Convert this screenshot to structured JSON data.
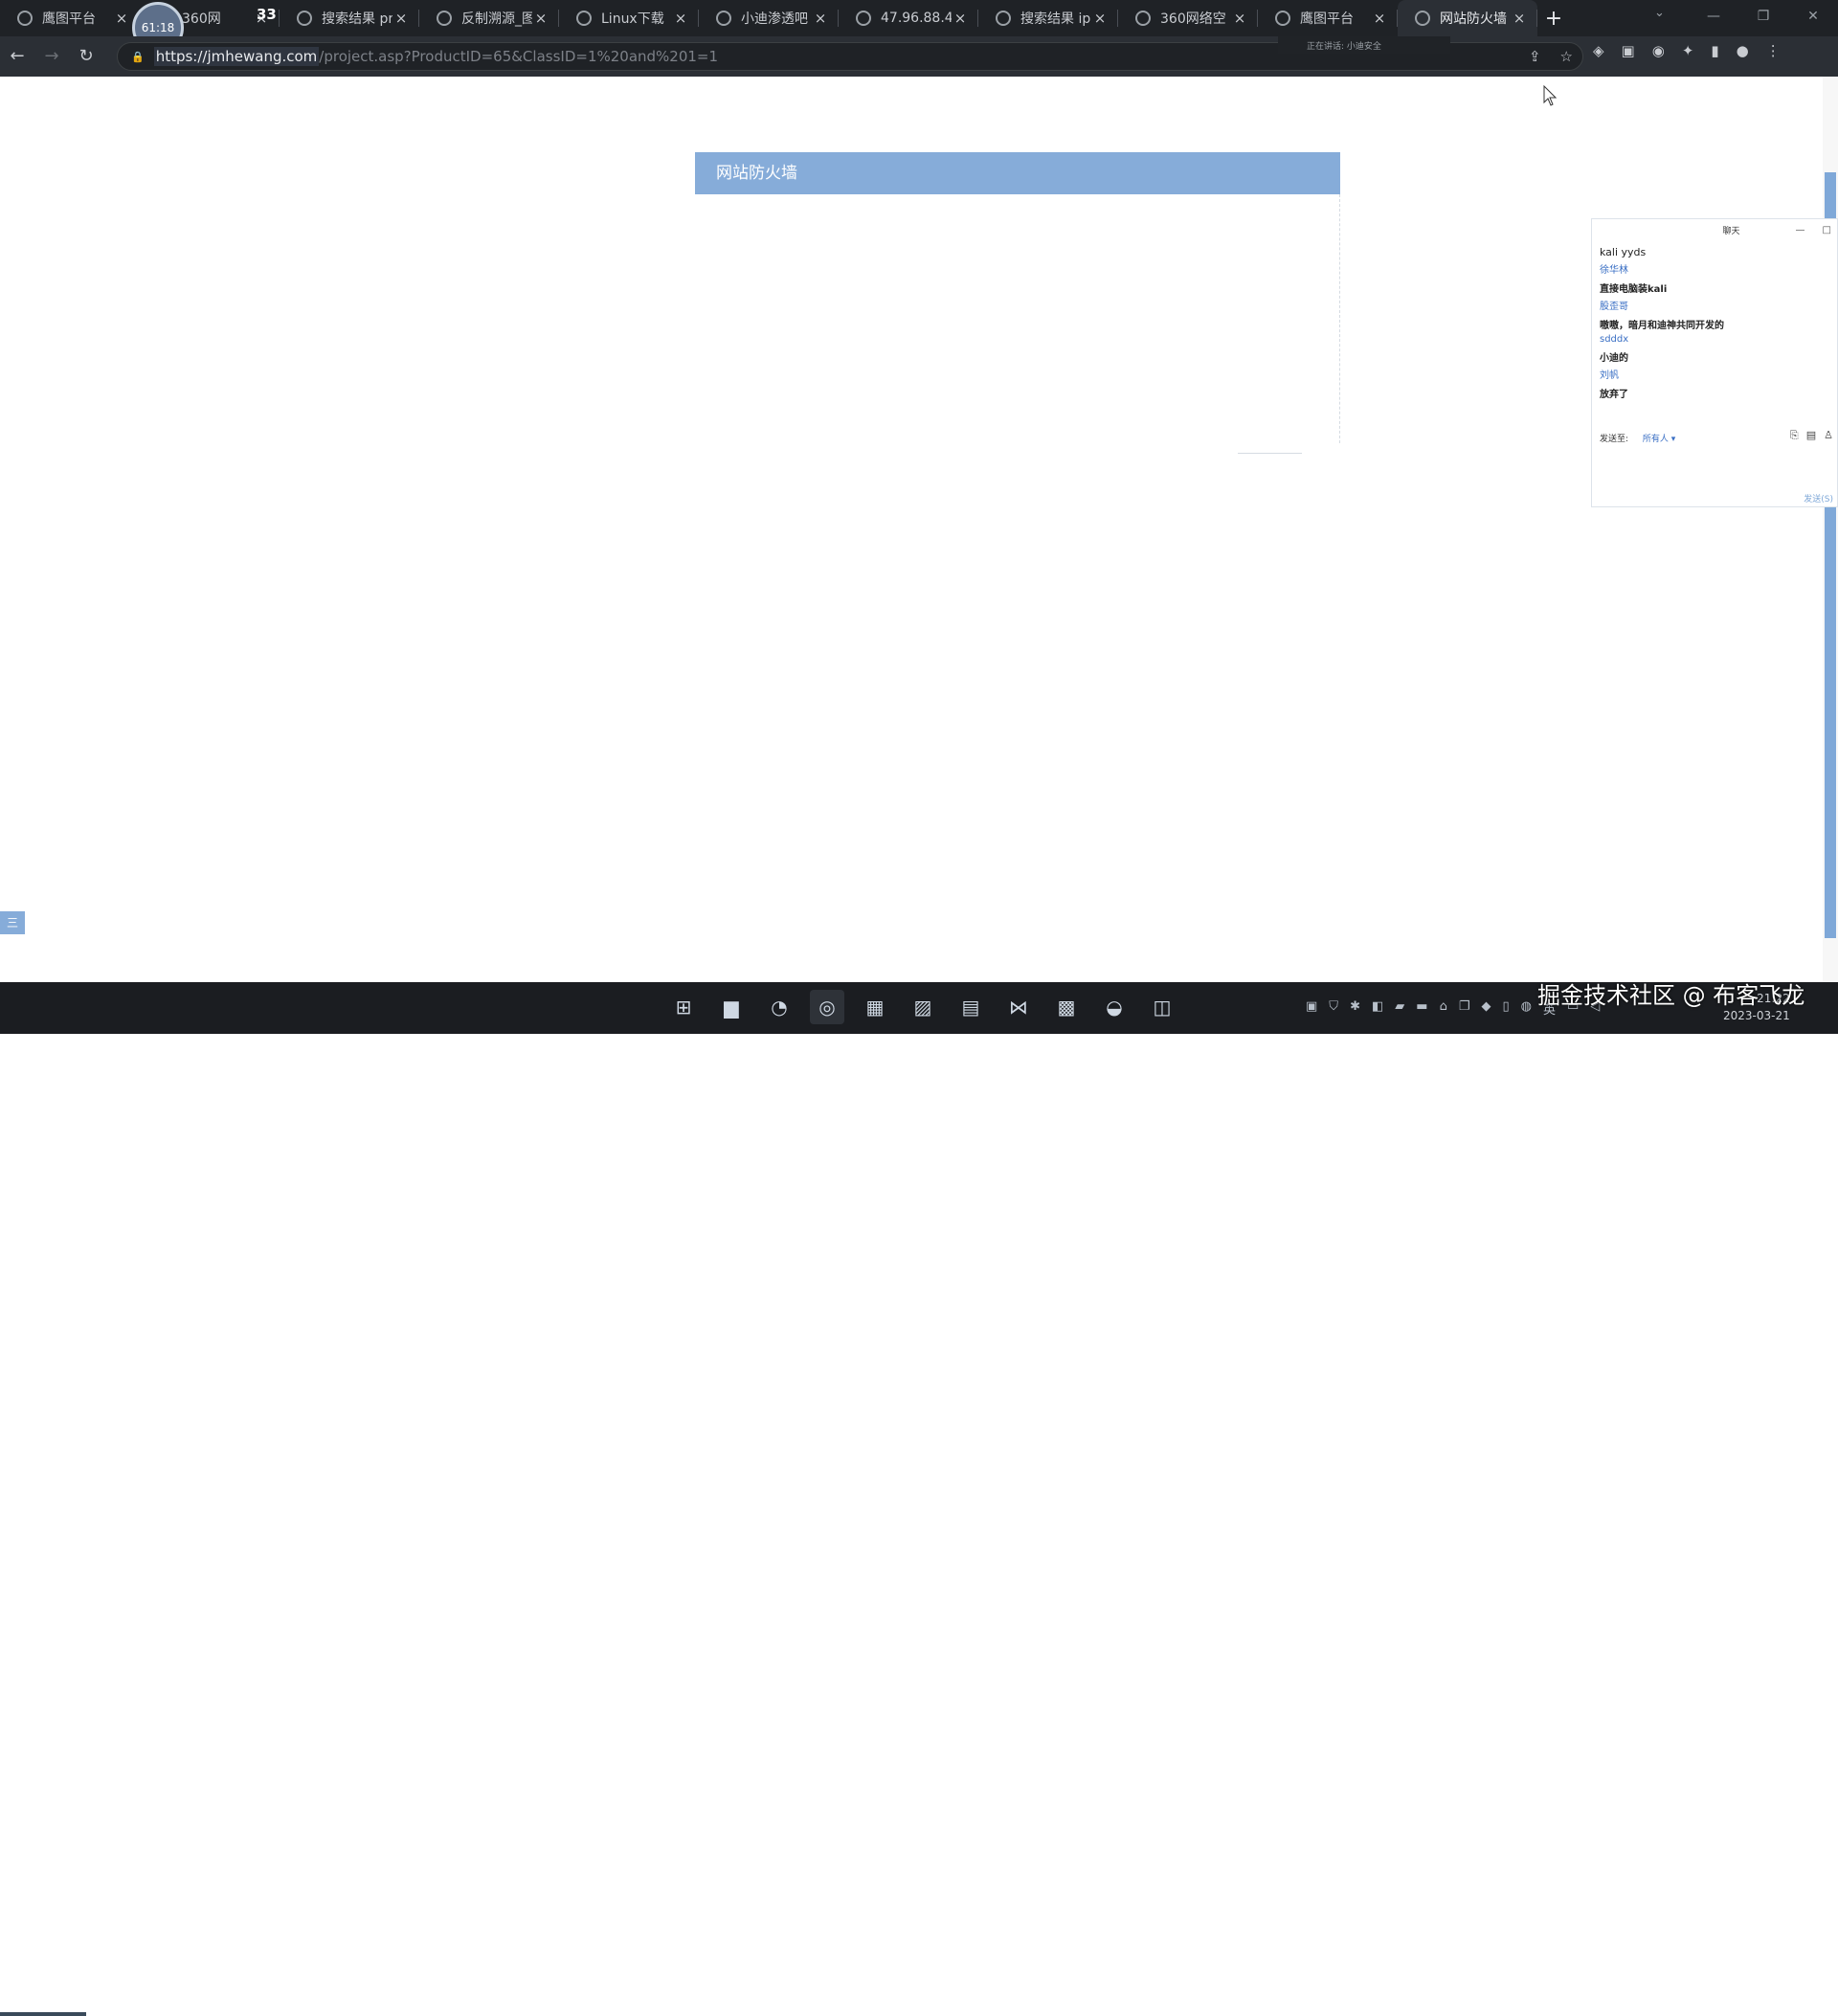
{
  "browser": {
    "tabs": [
      {
        "label": "鹰图平台",
        "icon": "hawk-icon"
      },
      {
        "label": "360网",
        "icon": "globe-icon"
      },
      {
        "label": "搜索结果 pr",
        "icon": "search-icon"
      },
      {
        "label": "反制溯源_图",
        "icon": "globe-icon"
      },
      {
        "label": "Linux下载",
        "icon": "globe-icon"
      },
      {
        "label": "小迪渗透吧",
        "icon": "globe-icon"
      },
      {
        "label": "47.96.88.4/",
        "icon": "globe-icon"
      },
      {
        "label": "搜索结果 ip",
        "icon": "search-icon"
      },
      {
        "label": "360网络空",
        "icon": "globe-icon"
      },
      {
        "label": "鹰图平台",
        "icon": "hawk-icon"
      },
      {
        "label": "网站防火墙",
        "icon": "globe-icon",
        "active": true
      }
    ],
    "close_glyph": "×",
    "new_tab_glyph": "+",
    "url_host": "https://jmhewang.com",
    "url_path": "/project.asp?ProductID=65&ClassID=1%20and%201=1",
    "speaking_text": "正在讲话: 小迪安全",
    "camera_label": "61:18",
    "floating_number": "33",
    "tiny_top_text": "80 3\n2 5"
  },
  "page": {
    "firewall_title": "网站防火墙",
    "side_tab_label": "三"
  },
  "chat": {
    "title": "聊天",
    "first_message": "kali  yyds",
    "messages": [
      {
        "user": "徐华林",
        "text": "直接电脑装kali"
      },
      {
        "user": "股歪哥",
        "text": "嗷嗷，暗月和迪神共同开发的"
      },
      {
        "user": "sdddx",
        "text": "小迪的"
      },
      {
        "user": "刘帆",
        "text": "放弃了"
      }
    ],
    "send_to_label": "发送至:",
    "send_to_value": "所有人",
    "send_button": "发送(S)"
  },
  "taskbar": {
    "apps": [
      "windows-start-icon",
      "file-explorer-icon",
      "edge-icon",
      "chrome-icon",
      "store-icon",
      "photos-icon",
      "notepad-icon",
      "vscode-icon",
      "remote-desktop-icon",
      "meeting-icon",
      "vmware-icon"
    ],
    "ime_label": "英",
    "time": "21:22",
    "date": "2023-03-21",
    "watermark": "掘金技术社区 @ 布客飞龙"
  }
}
